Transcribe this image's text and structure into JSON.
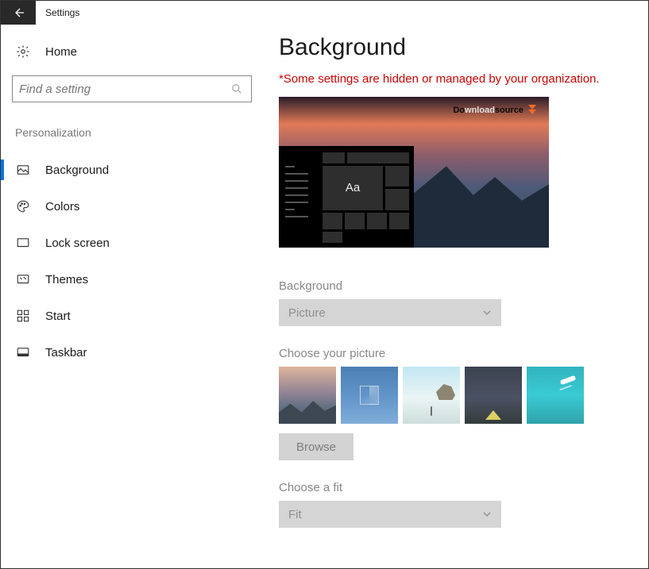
{
  "window": {
    "title": "Settings"
  },
  "home": {
    "label": "Home"
  },
  "search": {
    "placeholder": "Find a setting"
  },
  "section": {
    "label": "Personalization"
  },
  "nav": {
    "items": [
      {
        "label": "Background"
      },
      {
        "label": "Colors"
      },
      {
        "label": "Lock screen"
      },
      {
        "label": "Themes"
      },
      {
        "label": "Start"
      },
      {
        "label": "Taskbar"
      }
    ]
  },
  "page": {
    "title": "Background",
    "warning": "*Some settings are hidden or managed by your organization."
  },
  "preview": {
    "sample_text": "Aa",
    "watermark_prefix": "Do",
    "watermark_mid": "wnload",
    "watermark_suffix": "source"
  },
  "background_field": {
    "label": "Background",
    "value": "Picture"
  },
  "choose_picture": {
    "label": "Choose your picture",
    "browse_label": "Browse"
  },
  "fit_field": {
    "label": "Choose a fit",
    "value": "Fit"
  }
}
